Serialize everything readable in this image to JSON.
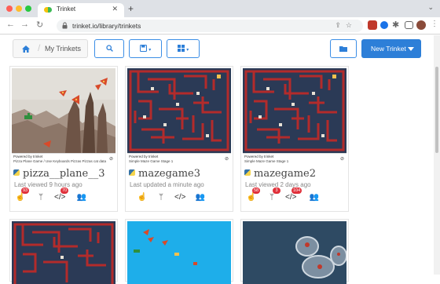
{
  "browser": {
    "tab_title": "Trinket",
    "url": "trinket.io/library/trinkets"
  },
  "header": {
    "breadcrumb_label": "My Trinkets",
    "new_trinket_label": "New Trinket"
  },
  "cards": [
    {
      "title": "pizza__plane__3",
      "subtitle": "Last viewed 9 hours ago",
      "powered_by": "Powered by trinket",
      "strip_desc": "Pizza Plane Game / Use Keyboards Pizzas Pizzas cat data",
      "badges": {
        "remix": "93",
        "embed": "70"
      }
    },
    {
      "title": "mazegame3",
      "subtitle": "Last updated a minute ago",
      "powered_by": "Powered by trinket",
      "strip_desc": "Simple Maze Game Stage 1",
      "badges": {}
    },
    {
      "title": "mazegame2",
      "subtitle": "Last viewed 2 days ago",
      "powered_by": "Powered by trinket",
      "strip_desc": "Simple Maze Game Stage 1",
      "badges": {
        "remix": "58",
        "fork": "3",
        "embed": "104"
      }
    }
  ],
  "colors": {
    "accent": "#2d7fd8",
    "badge": "#e0303a",
    "maze_bg": "#2b3a56",
    "maze_wall": "#b32b2b",
    "sky": "#1eaeea"
  }
}
